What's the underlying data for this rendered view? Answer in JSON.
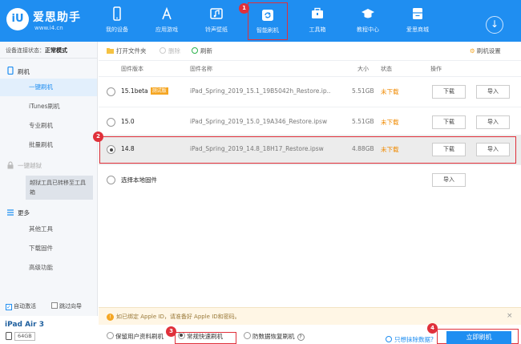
{
  "app": {
    "logo_badge": "iU",
    "name": "爱思助手",
    "url": "www.i4.cn"
  },
  "nav": [
    {
      "label": "我的设备",
      "icon": "phone-icon"
    },
    {
      "label": "应用游戏",
      "icon": "appstore-icon"
    },
    {
      "label": "铃声壁纸",
      "icon": "music-icon"
    },
    {
      "label": "智能刷机",
      "icon": "refresh-icon"
    },
    {
      "label": "工具箱",
      "icon": "toolbox-icon"
    },
    {
      "label": "教程中心",
      "icon": "graduation-cap-icon"
    },
    {
      "label": "爱思商城",
      "icon": "store-icon"
    }
  ],
  "download_icon": "↓",
  "steps": {
    "s1": "1",
    "s2": "2",
    "s3": "3",
    "s4": "4"
  },
  "sidebar": {
    "status_prefix": "设备连接状态：",
    "status_value": "正常模式",
    "group_flash": "刷机",
    "items_flash": [
      "一键刷机",
      "iTunes刷机",
      "专业刷机",
      "批量刷机"
    ],
    "group_jailbreak": "一键越狱",
    "jailbreak_note": "越狱工具已转移至工具箱",
    "group_more": "更多",
    "items_more": [
      "其他工具",
      "下载固件",
      "高级功能"
    ],
    "auto_activate": "自动激活",
    "skip_guide": "跳过向导",
    "device_name": "iPad Air 3",
    "device_capacity": "64GB"
  },
  "toolbar": {
    "open_folder": "打开文件夹",
    "delete": "删除",
    "refresh": "刷新",
    "settings": "刷机设置"
  },
  "table": {
    "headers": {
      "version": "固件版本",
      "name": "固件名称",
      "size": "大小",
      "status": "状态",
      "action": "操作"
    },
    "rows": [
      {
        "version": "15.1beta",
        "badge": "测试版",
        "name": "iPad_Spring_2019_15.1_19B5042h_Restore.ip...",
        "size": "5.51GB",
        "status": "未下载",
        "download": "下载",
        "import": "导入",
        "selected": false
      },
      {
        "version": "15.0",
        "badge": "",
        "name": "iPad_Spring_2019_15.0_19A346_Restore.ipsw",
        "size": "5.51GB",
        "status": "未下载",
        "download": "下载",
        "import": "导入",
        "selected": false
      },
      {
        "version": "14.8",
        "badge": "",
        "name": "iPad_Spring_2019_14.8_18H17_Restore.ipsw",
        "size": "4.88GB",
        "status": "未下载",
        "download": "下载",
        "import": "导入",
        "selected": true
      }
    ],
    "local_label": "选择本地固件",
    "local_import": "导入"
  },
  "notice": {
    "text": "如已绑定 Apple ID，请准备好 Apple ID和密码。",
    "close": "×"
  },
  "bottom": {
    "mode_keep": "保留用户资料刷机",
    "mode_fast": "常规快速刷机",
    "mode_recover": "防数据恢复刷机",
    "help": "?",
    "erase_link": "只想抹除数据?",
    "flash_button": "立即刷机"
  },
  "colors": {
    "accent": "#1f8ef1",
    "highlight": "#e0303a",
    "warning": "#f08a00"
  }
}
